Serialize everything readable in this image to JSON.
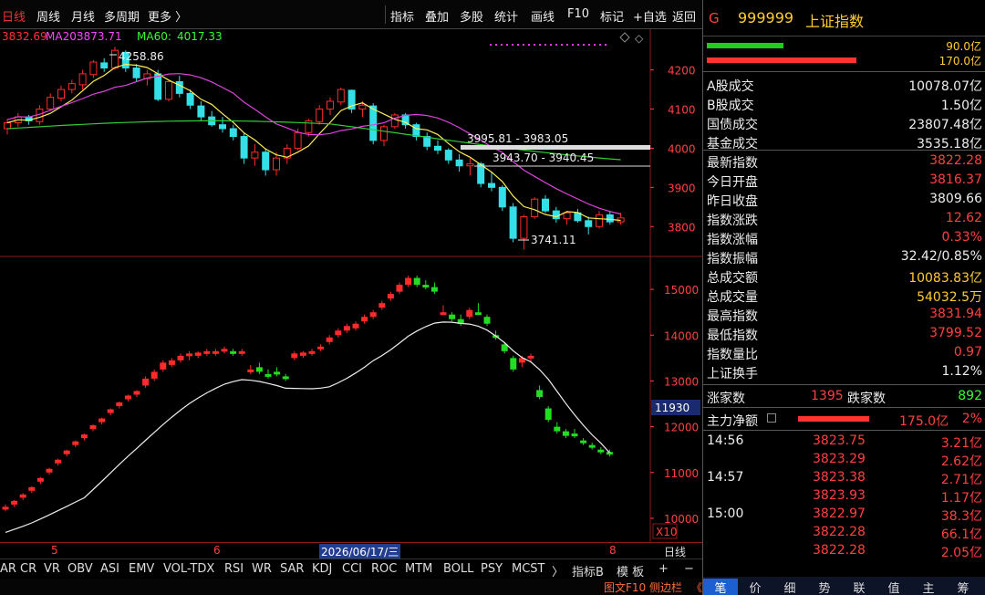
{
  "toolbar": {
    "left": [
      "日线",
      "周线",
      "月线",
      "多周期",
      "更多 〉"
    ],
    "right": [
      "指标",
      "叠加",
      "多股",
      "统计",
      "画线",
      "F10",
      "标记",
      "+自选",
      "返回"
    ]
  },
  "ma_legend": {
    "ma10": "3832.69",
    "ma20_label": "MA20:",
    "ma20": "3873.71",
    "ma60_label": "MA60:",
    "ma60": "4017.33",
    "colors": {
      "ma10": "#ff3333",
      "ma20": "#ff44ff",
      "ma60": "#33ff33"
    }
  },
  "price_annotations": [
    "4258.86",
    "3995.81 - 3983.05",
    "3943.70 - 3940.45",
    "3741.11"
  ],
  "chart_data": [
    {
      "type": "candlestick",
      "ylim": [
        3740,
        4290
      ],
      "y_ticks": [
        3800,
        3900,
        4000,
        4100,
        4200
      ],
      "candles": [
        [
          4050,
          4075,
          4035,
          4065
        ],
        [
          4065,
          4090,
          4055,
          4080
        ],
        [
          4080,
          4085,
          4060,
          4070
        ],
        [
          4068,
          4110,
          4060,
          4100
        ],
        [
          4100,
          4140,
          4095,
          4130
        ],
        [
          4128,
          4160,
          4120,
          4150
        ],
        [
          4150,
          4175,
          4140,
          4165
        ],
        [
          4162,
          4200,
          4150,
          4190
        ],
        [
          4188,
          4225,
          4180,
          4220
        ],
        [
          4218,
          4230,
          4195,
          4205
        ],
        [
          4205,
          4259,
          4200,
          4250
        ],
        [
          4245,
          4250,
          4195,
          4205
        ],
        [
          4205,
          4215,
          4170,
          4180
        ],
        [
          4178,
          4200,
          4160,
          4190
        ],
        [
          4190,
          4200,
          4120,
          4125
        ],
        [
          4125,
          4175,
          4120,
          4170
        ],
        [
          4170,
          4185,
          4130,
          4140
        ],
        [
          4140,
          4150,
          4100,
          4110
        ],
        [
          4108,
          4120,
          4070,
          4080
        ],
        [
          4080,
          4095,
          4055,
          4060
        ],
        [
          4060,
          4080,
          4040,
          4050
        ],
        [
          4050,
          4060,
          4020,
          4030
        ],
        [
          4030,
          4040,
          3960,
          3975
        ],
        [
          3975,
          4010,
          3955,
          3990
        ],
        [
          3990,
          4000,
          3930,
          3945
        ],
        [
          3945,
          3990,
          3930,
          3975
        ],
        [
          3975,
          4010,
          3960,
          4000
        ],
        [
          4000,
          4050,
          3995,
          4040
        ],
        [
          4040,
          4075,
          4030,
          4070
        ],
        [
          4068,
          4110,
          4060,
          4100
        ],
        [
          4100,
          4130,
          4085,
          4120
        ],
        [
          4118,
          4155,
          4110,
          4150
        ],
        [
          4148,
          4150,
          4090,
          4100
        ],
        [
          4100,
          4120,
          4080,
          4110
        ],
        [
          4108,
          4115,
          4010,
          4020
        ],
        [
          4020,
          4060,
          4005,
          4055
        ],
        [
          4055,
          4090,
          4050,
          4085
        ],
        [
          4085,
          4090,
          4050,
          4060
        ],
        [
          4060,
          4065,
          4020,
          4030
        ],
        [
          4030,
          4040,
          3995,
          4005
        ],
        [
          4005,
          4020,
          3985,
          3995
        ],
        [
          3995,
          4000,
          3960,
          3970
        ],
        [
          3970,
          3985,
          3940,
          3955
        ],
        [
          3955,
          3975,
          3930,
          3960
        ],
        [
          3960,
          3965,
          3900,
          3910
        ],
        [
          3910,
          3940,
          3890,
          3900
        ],
        [
          3900,
          3905,
          3840,
          3850
        ],
        [
          3850,
          3860,
          3760,
          3770
        ],
        [
          3770,
          3830,
          3741,
          3825
        ],
        [
          3825,
          3875,
          3820,
          3870
        ],
        [
          3870,
          3880,
          3835,
          3840
        ],
        [
          3840,
          3850,
          3810,
          3820
        ],
        [
          3820,
          3840,
          3805,
          3835
        ],
        [
          3835,
          3845,
          3810,
          3815
        ],
        [
          3815,
          3825,
          3780,
          3800
        ],
        [
          3800,
          3840,
          3795,
          3830
        ],
        [
          3830,
          3840,
          3805,
          3812
        ],
        [
          3812,
          3835,
          3805,
          3822
        ]
      ]
    },
    {
      "type": "candlestick",
      "ylim": [
        9600,
        15600
      ],
      "y_ticks": [
        10000,
        11000,
        12000,
        13000,
        14000,
        15000
      ],
      "current_value": "11930",
      "zoom_label": "X10",
      "candles": [
        [
          10200,
          10300,
          10150,
          10250
        ],
        [
          10300,
          10400,
          10250,
          10380
        ],
        [
          10450,
          10550,
          10400,
          10520
        ],
        [
          10600,
          10700,
          10550,
          10680
        ],
        [
          10800,
          10900,
          10750,
          10880
        ],
        [
          11000,
          11100,
          10950,
          11080
        ],
        [
          11200,
          11300,
          11150,
          11280
        ],
        [
          11400,
          11500,
          11350,
          11480
        ],
        [
          11600,
          11700,
          11550,
          11680
        ],
        [
          11750,
          11850,
          11700,
          11830
        ],
        [
          11950,
          12050,
          11900,
          12030
        ],
        [
          12100,
          12200,
          12050,
          12180
        ],
        [
          12300,
          12400,
          12250,
          12380
        ],
        [
          12450,
          12550,
          12400,
          12530
        ],
        [
          12600,
          12700,
          12550,
          12680
        ],
        [
          12700,
          12800,
          12650,
          12780
        ],
        [
          12900,
          13100,
          12850,
          13050
        ],
        [
          13050,
          13250,
          13000,
          13200
        ],
        [
          13250,
          13450,
          13200,
          13400
        ],
        [
          13350,
          13500,
          13300,
          13450
        ],
        [
          13450,
          13600,
          13400,
          13550
        ],
        [
          13550,
          13650,
          13450,
          13600
        ],
        [
          13550,
          13650,
          13500,
          13620
        ],
        [
          13600,
          13700,
          13550,
          13650
        ],
        [
          13600,
          13700,
          13550,
          13650
        ],
        [
          13650,
          13750,
          13600,
          13700
        ],
        [
          13650,
          13700,
          13550,
          13600
        ],
        [
          13600,
          13700,
          13550,
          13650
        ],
        [
          13200,
          13350,
          13150,
          13250
        ],
        [
          13300,
          13400,
          13150,
          13200
        ],
        [
          13150,
          13250,
          13050,
          13100
        ],
        [
          13200,
          13300,
          13100,
          13150
        ],
        [
          13100,
          13150,
          13000,
          13050
        ],
        [
          13500,
          13650,
          13450,
          13600
        ],
        [
          13550,
          13650,
          13500,
          13620
        ],
        [
          13600,
          13700,
          13550,
          13650
        ],
        [
          13700,
          13800,
          13650,
          13750
        ],
        [
          13850,
          14000,
          13800,
          13950
        ],
        [
          14000,
          14150,
          13950,
          14100
        ],
        [
          14100,
          14250,
          14050,
          14200
        ],
        [
          14150,
          14300,
          14100,
          14250
        ],
        [
          14300,
          14450,
          14250,
          14400
        ],
        [
          14400,
          14550,
          14350,
          14500
        ],
        [
          14600,
          14750,
          14550,
          14700
        ],
        [
          14800,
          14950,
          14750,
          14900
        ],
        [
          14950,
          15150,
          14900,
          15100
        ],
        [
          15100,
          15300,
          15050,
          15250
        ],
        [
          15250,
          15300,
          15050,
          15100
        ],
        [
          15100,
          15200,
          15000,
          15050
        ],
        [
          15050,
          15150,
          14900,
          14950
        ],
        [
          14500,
          14650,
          14450,
          14500
        ],
        [
          14450,
          14500,
          14300,
          14350
        ],
        [
          14350,
          14450,
          14200,
          14250
        ],
        [
          14400,
          14600,
          14350,
          14550
        ],
        [
          14500,
          14700,
          14450,
          14450
        ],
        [
          14400,
          14450,
          14200,
          14250
        ],
        [
          14000,
          14100,
          13900,
          13950
        ],
        [
          13800,
          13850,
          13600,
          13650
        ],
        [
          13500,
          13550,
          13200,
          13250
        ],
        [
          13400,
          13550,
          13300,
          13500
        ],
        [
          13500,
          13600,
          13400,
          13550
        ],
        [
          12800,
          12900,
          12600,
          12650
        ],
        [
          12400,
          12450,
          12100,
          12150
        ],
        [
          12000,
          12100,
          11850,
          11900
        ],
        [
          11900,
          11950,
          11750,
          11800
        ],
        [
          11850,
          11950,
          11750,
          11800
        ],
        [
          11700,
          11750,
          11600,
          11650
        ],
        [
          11600,
          11650,
          11500,
          11550
        ],
        [
          11500,
          11550,
          11400,
          11450
        ],
        [
          11450,
          11500,
          11350,
          11400
        ]
      ]
    }
  ],
  "xaxis": {
    "labels": [
      "5",
      "6",
      "2026/06/17/三",
      "8"
    ],
    "right_label": "日线"
  },
  "indicator_tabs": [
    "AR",
    "CR",
    "VR",
    "OBV",
    "ASI",
    "EMV",
    "VOL-TDX",
    "RSI",
    "WR",
    "SAR",
    "KDJ",
    "CCI",
    "ROC",
    "MTM",
    "BOLL",
    "PSY",
    "MCST",
    "〉",
    "指标B",
    "模 板",
    "+",
    "−"
  ],
  "bottom_bar": {
    "f10": "图文F10",
    "sidebar": "侧边栏",
    "arrow": "《"
  },
  "header": {
    "code_prefix": "G",
    "code": "999999",
    "name": "上证指数"
  },
  "bars": {
    "top_val": "90.0亿",
    "bottom_val": "170.0亿"
  },
  "stats": [
    {
      "label": "A股成交",
      "value": "10078.07亿",
      "color": "#eeeeee"
    },
    {
      "label": "B股成交",
      "value": "1.50亿",
      "color": "#eeeeee"
    },
    {
      "label": "国债成交",
      "value": "23807.48亿",
      "color": "#eeeeee"
    },
    {
      "label": "基金成交",
      "value": "3535.18亿",
      "color": "#eeeeee"
    },
    {
      "label": "最新指数",
      "value": "3822.28",
      "color": "#ff4040"
    },
    {
      "label": "今日开盘",
      "value": "3816.37",
      "color": "#ff4040"
    },
    {
      "label": "昨日收盘",
      "value": "3809.66",
      "color": "#eeeeee"
    },
    {
      "label": "指数涨跌",
      "value": "12.62",
      "color": "#ff4040"
    },
    {
      "label": "指数涨幅",
      "value": "0.33%",
      "color": "#ff4040"
    },
    {
      "label": "指数振幅",
      "value": "32.42/0.85%",
      "color": "#eeeeee"
    },
    {
      "label": "总成交额",
      "value": "10083.83亿",
      "color": "#ffcc33"
    },
    {
      "label": "总成交量",
      "value": "54032.5万",
      "color": "#ffcc33"
    },
    {
      "label": "最高指数",
      "value": "3831.94",
      "color": "#ff4040"
    },
    {
      "label": "最低指数",
      "value": "3799.52",
      "color": "#ff4040"
    },
    {
      "label": "指数量比",
      "value": "0.97",
      "color": "#ff4040"
    },
    {
      "label": "上证换手",
      "value": "1.12%",
      "color": "#eeeeee"
    }
  ],
  "updown": {
    "up_label": "涨家数",
    "up": "1395",
    "down_label": "跌家数",
    "down": "892"
  },
  "mainflow": {
    "label": "主力净额",
    "value": "175.0亿",
    "pct": "2%"
  },
  "ticks": [
    {
      "time": "14:56",
      "price": "3823.75",
      "vol": "3.21亿"
    },
    {
      "time": "",
      "price": "3823.29",
      "vol": "2.62亿"
    },
    {
      "time": "14:57",
      "price": "3823.38",
      "vol": "2.71亿"
    },
    {
      "time": "",
      "price": "3823.93",
      "vol": "1.17亿"
    },
    {
      "time": "15:00",
      "price": "3822.97",
      "vol": "38.3亿"
    },
    {
      "time": "",
      "price": "3822.28",
      "vol": "66.1亿"
    },
    {
      "time": "",
      "price": "3822.28",
      "vol": "2.05亿"
    }
  ],
  "rtabs": [
    "笔",
    "价",
    "细",
    "势",
    "联",
    "值",
    "主",
    "筹"
  ]
}
